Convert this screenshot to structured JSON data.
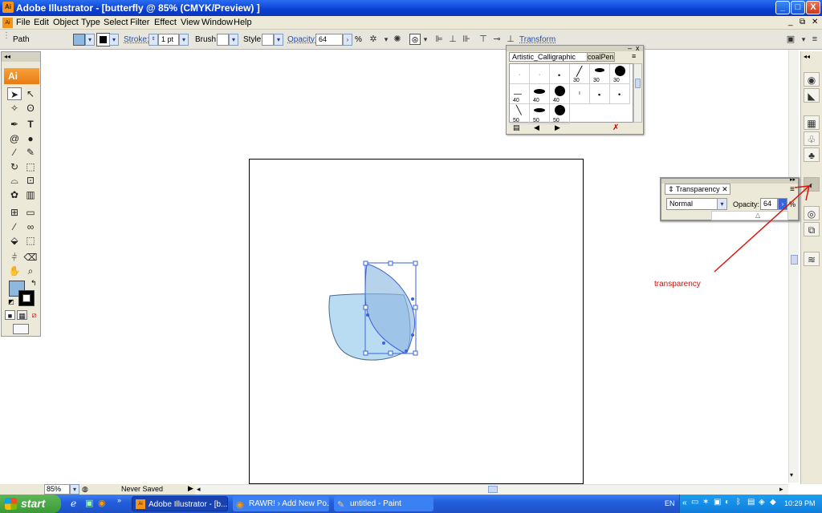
{
  "window": {
    "title": "Adobe Illustrator - [butterfly @ 85% (CMYK/Preview) ]",
    "app_icon_text": "Ai",
    "buttons": {
      "minimize": "_",
      "maximize": "□",
      "close": "X"
    }
  },
  "menu": [
    "File",
    "Edit",
    "Object",
    "Type",
    "Select",
    "Filter",
    "Effect",
    "View",
    "Window",
    "Help"
  ],
  "controlbar": {
    "selection_type": "Path",
    "stroke_label": "Stroke:",
    "stroke_value": "1 pt",
    "brush_label": "Brush:",
    "style_label": "Style:",
    "opacity_label": "Opacity:",
    "opacity_value": "64",
    "percent": "%",
    "transform_label": "Transform"
  },
  "toolpanel": {
    "header": "Ai"
  },
  "brush_panel": {
    "tabs": [
      "Artistic_Calligraphic",
      "coalPencil"
    ],
    "rows": [
      [
        "",
        "",
        "",
        "30",
        "30",
        "30"
      ],
      [
        "40",
        "40",
        "40",
        "",
        "",
        ""
      ],
      [
        "50",
        "50",
        "50"
      ]
    ]
  },
  "transparency_panel": {
    "title": "Transparency",
    "blend_mode": "Normal",
    "opacity_label": "Opacity:",
    "opacity_value": "64",
    "percent": "%"
  },
  "annotation": {
    "text": "transparency",
    "color": "#c8140c"
  },
  "statusbar": {
    "zoom": "85%",
    "status": "Never Saved"
  },
  "taskbar": {
    "start_label": "start",
    "items": [
      "Adobe Illustrator - [b...",
      "RAWR! › Add New Po...",
      "untitled - Paint"
    ],
    "tray_lang": "EN",
    "clock": "10:29 PM"
  },
  "colors": {
    "fill": "#8fb8e0",
    "shape_fill": "#b9dcf3",
    "selection": "#3a63d8",
    "accent_orange": "#f29419"
  }
}
